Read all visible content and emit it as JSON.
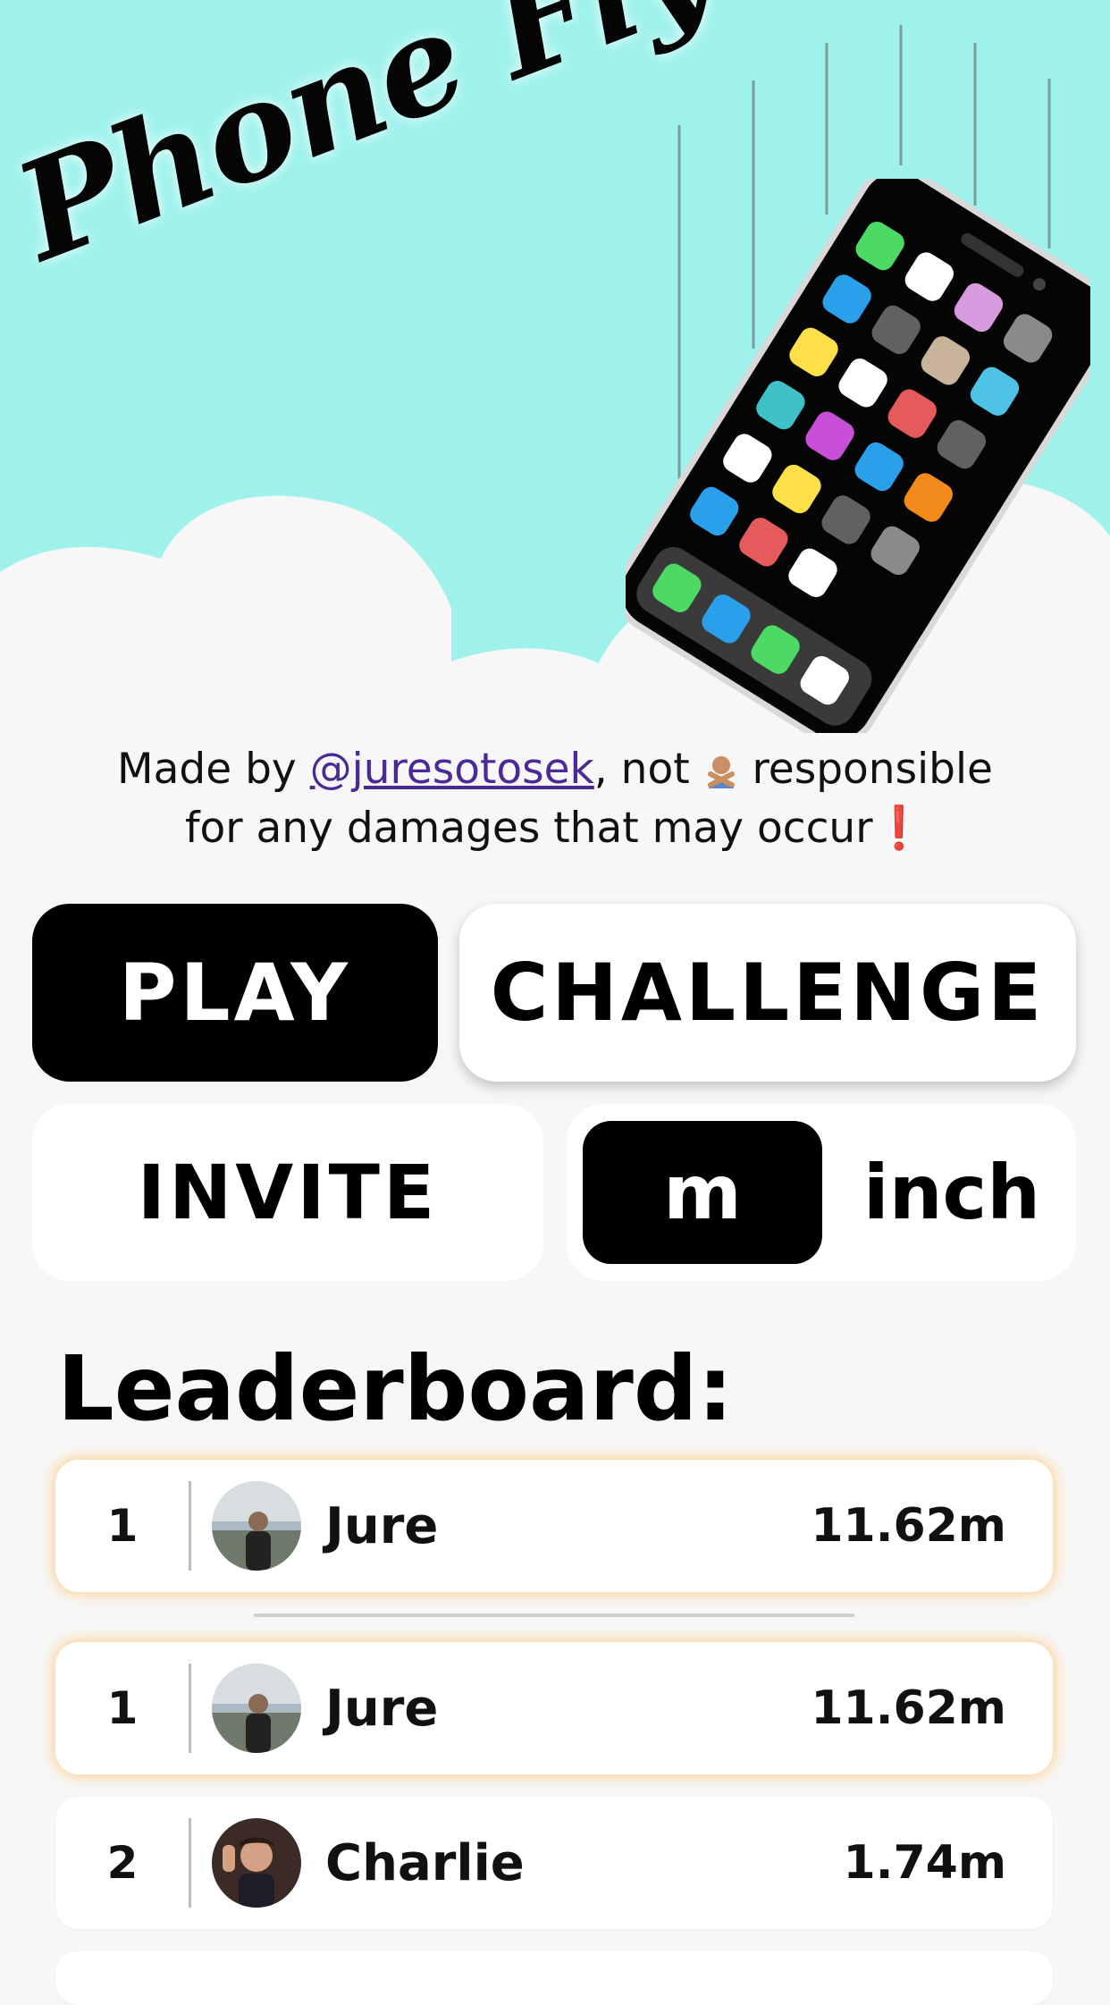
{
  "app": {
    "title": "Phone Fly",
    "colors": {
      "sky": "#9ff2ec",
      "background": "#f7f7f7",
      "accent_link": "#4b2a97",
      "highlight_glow": "#ffc878"
    }
  },
  "credit": {
    "prefix": "Made by ",
    "handle": "@juresotosek",
    "middle": ", not ",
    "suffix": " responsible",
    "line2": "for any damages that may occur",
    "exclamation": "❗",
    "icon": "person-facepalm-icon"
  },
  "buttons": {
    "play": "PLAY",
    "challenge": "CHALLENGE",
    "invite": "INVITE"
  },
  "units": {
    "options": [
      "m",
      "inch"
    ],
    "selected": "m"
  },
  "leaderboard": {
    "title": "Leaderboard:",
    "current_user": {
      "rank": "1",
      "name": "Jure",
      "score": "11.62m"
    },
    "entries": [
      {
        "rank": "1",
        "name": "Jure",
        "score": "11.62m"
      },
      {
        "rank": "2",
        "name": "Charlie",
        "score": "1.74m"
      }
    ]
  }
}
